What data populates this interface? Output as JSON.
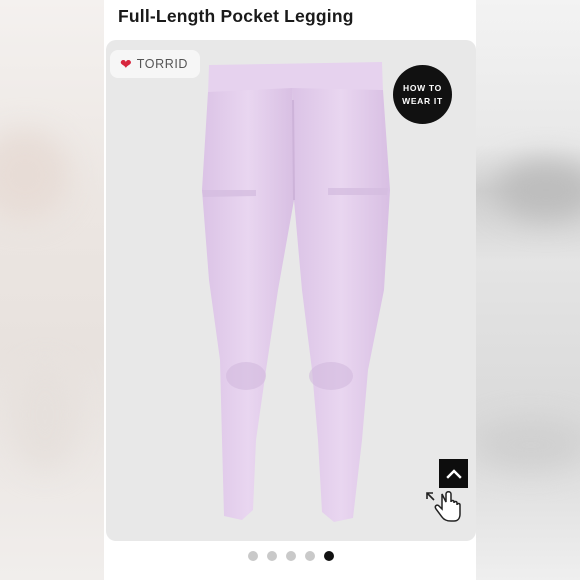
{
  "product": {
    "title": "Full-Length Pocket Legging",
    "color_swatch": "#e3cdec"
  },
  "brand_tag": {
    "icon": "heart-icon",
    "heart_char": "❤",
    "label": "TORRID"
  },
  "how_to_wear": {
    "label": "HOW TO WEAR IT"
  },
  "scroll_top": {
    "icon": "chevron-up-icon"
  },
  "zoom": {
    "icon": "hand-pointer-zoom-icon"
  },
  "carousel": {
    "total": 5,
    "active_index": 4
  }
}
